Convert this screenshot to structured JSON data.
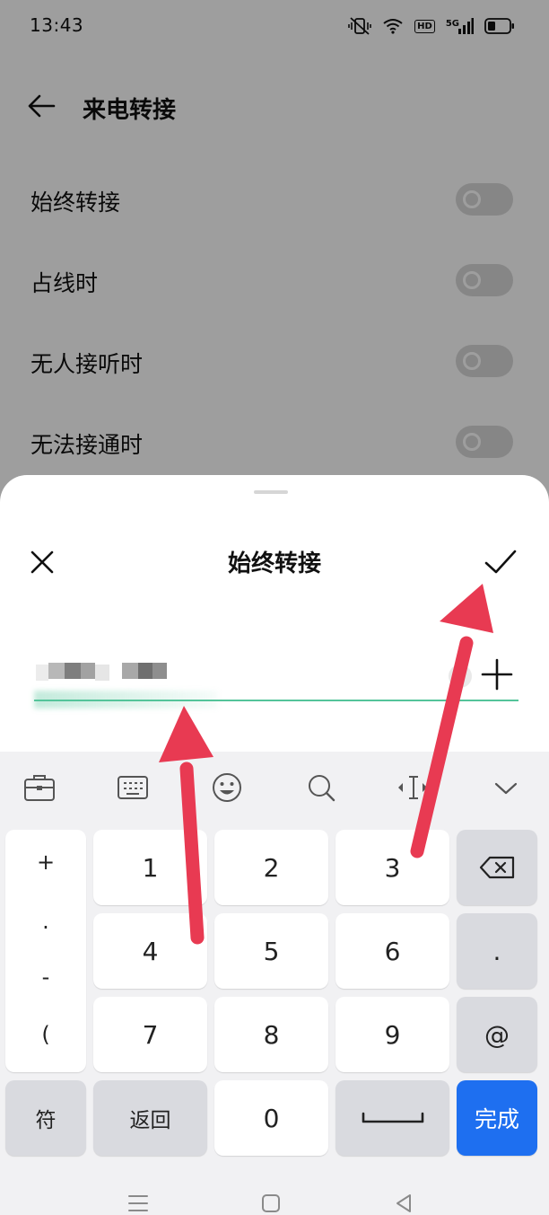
{
  "status_bar": {
    "time": "13:43",
    "network": "5G",
    "hd": "HD"
  },
  "page": {
    "title": "来电转接",
    "rows": [
      {
        "label": "始终转接",
        "enabled": false
      },
      {
        "label": "占线时",
        "enabled": false
      },
      {
        "label": "无人接听时",
        "enabled": false
      },
      {
        "label": "无法接通时",
        "enabled": false
      }
    ]
  },
  "sheet": {
    "title": "始终转接",
    "field_value": "",
    "accent": "#54c49a"
  },
  "keyboard": {
    "symbols": [
      "+",
      ".",
      "-",
      "("
    ],
    "digits": [
      "1",
      "2",
      "3",
      "4",
      "5",
      "6",
      "7",
      "8",
      "9",
      "0"
    ],
    "right_keys": [
      ".",
      "@"
    ],
    "symbol_key": "符",
    "back_key": "返回",
    "done_key": "完成",
    "done_color": "#1e6ff0"
  },
  "annotation_color": "#e83a52"
}
